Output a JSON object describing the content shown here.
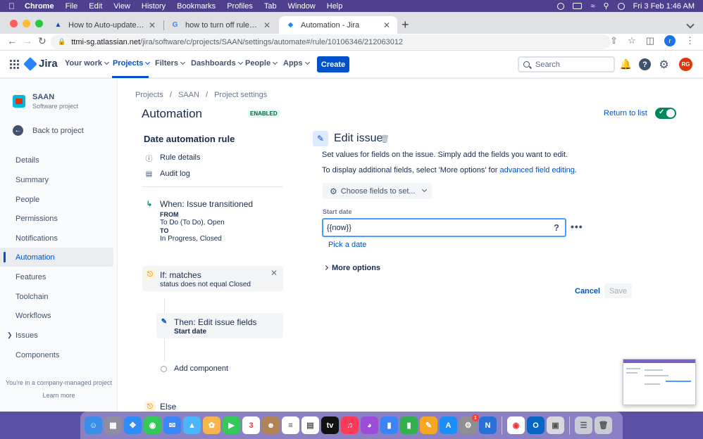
{
  "menubar": {
    "app": "Chrome",
    "items": [
      "File",
      "Edit",
      "View",
      "History",
      "Bookmarks",
      "Profiles",
      "Tab",
      "Window",
      "Help"
    ],
    "datetime": "Fri 3 Feb  1:46 AM"
  },
  "tabs": [
    {
      "title": "How to Auto-update Start & end"
    },
    {
      "title": "how to turn off rule in jira auton"
    },
    {
      "title": "Automation - Jira"
    }
  ],
  "address": {
    "host": "ttmi-sg.atlassian.net",
    "path": "/jira/software/c/projects/SAAN/settings/automate#/rule/10106346/212063012",
    "profile_initial": "r"
  },
  "jira_nav": {
    "logo": "Jira",
    "menus": [
      "Your work",
      "Projects",
      "Filters",
      "Dashboards",
      "People",
      "Apps"
    ],
    "create": "Create",
    "search_placeholder": "Search",
    "avatar": "RG"
  },
  "sidebar": {
    "project_name": "SAAN",
    "project_type": "Software project",
    "back": "Back to project",
    "items": [
      "Details",
      "Summary",
      "People",
      "Permissions",
      "Notifications",
      "Automation",
      "Features",
      "Toolchain",
      "Workflows",
      "Issues",
      "Components"
    ],
    "footer_text": "You're in a company-managed project",
    "footer_link": "Learn more"
  },
  "breadcrumbs": [
    "Projects",
    "/",
    "SAAN",
    "/",
    "Project settings"
  ],
  "page": {
    "title": "Automation",
    "status": "ENABLED",
    "return_link": "Return to list"
  },
  "rule": {
    "name": "Date automation rule",
    "details": "Rule details",
    "audit": "Audit log",
    "trigger": {
      "title": "When: Issue transitioned",
      "from_label": "FROM",
      "from_value": "To Do (To Do), Open",
      "to_label": "TO",
      "to_value": "In Progress, Closed"
    },
    "condition": {
      "title": "If: matches",
      "detail": "status does not equal Closed"
    },
    "action": {
      "title": "Then: Edit issue fields",
      "detail": "Start date"
    },
    "add_component": "Add component",
    "else": "Else"
  },
  "edit_panel": {
    "title": "Edit issue",
    "desc1": "Set values for fields on the issue. Simply add the fields you want to edit.",
    "desc2_prefix": "To display additional fields, select 'More options' for ",
    "desc2_link": "advanced field editing",
    "desc2_suffix": ".",
    "choose_fields": "Choose fields to set...",
    "field_label": "Start date",
    "field_value": "{{now}}",
    "pick_date": "Pick a date",
    "more_options": "More options",
    "cancel": "Cancel",
    "save": "Save"
  },
  "colors": {
    "accent": "#0052cc",
    "enabled_green": "#00875a",
    "brand_blue": "#2684ff"
  }
}
